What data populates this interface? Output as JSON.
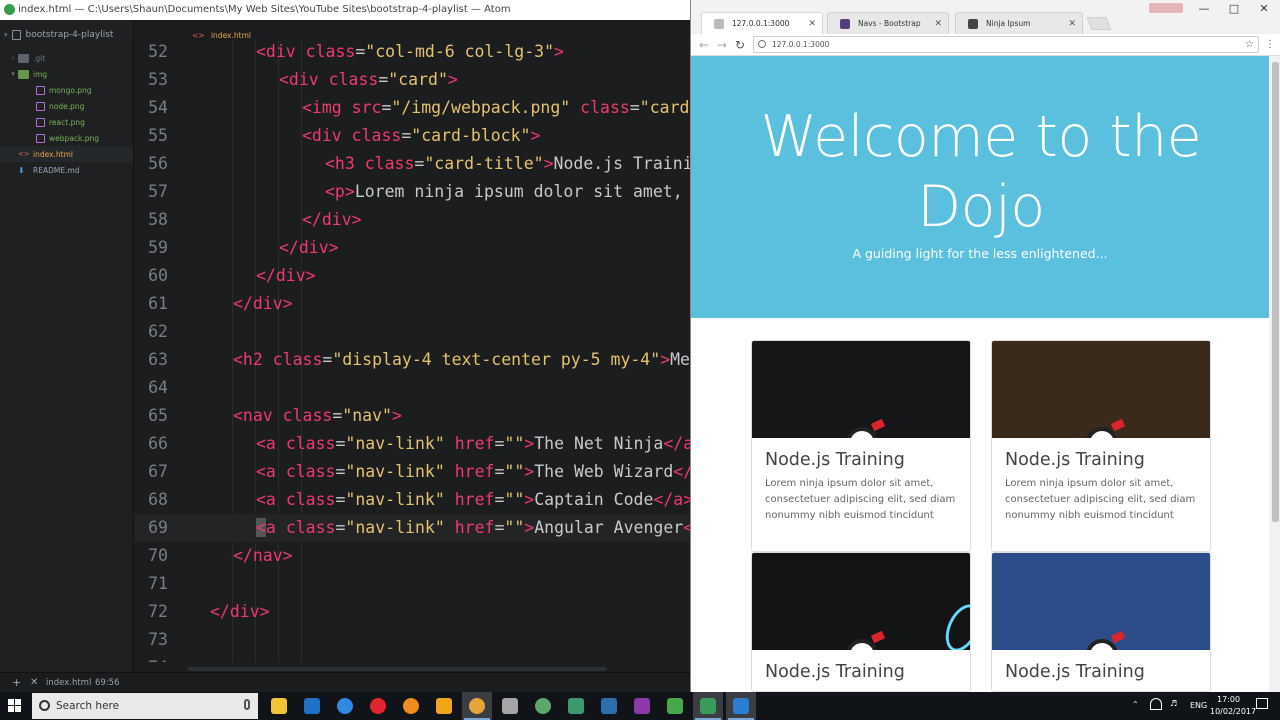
{
  "atom": {
    "title": "index.html — C:\\Users\\Shaun\\Documents\\My Web Sites\\YouTube Sites\\bootstrap-4-playlist — Atom",
    "project": "bootstrap-4-playlist",
    "tree": [
      {
        "label": ".git",
        "color": "#6e7681",
        "indent": 1,
        "kind": "folder",
        "open": false
      },
      {
        "label": "img",
        "color": "#79b45a",
        "indent": 1,
        "kind": "folder",
        "open": true
      },
      {
        "label": "mongo.png",
        "color": "#79b45a",
        "indent": 2,
        "kind": "image"
      },
      {
        "label": "node.png",
        "color": "#79b45a",
        "indent": 2,
        "kind": "image"
      },
      {
        "label": "react.png",
        "color": "#79b45a",
        "indent": 2,
        "kind": "image"
      },
      {
        "label": "webpack.png",
        "color": "#79b45a",
        "indent": 2,
        "kind": "image"
      },
      {
        "label": "index.html",
        "color": "#e6a34c",
        "indent": 1,
        "kind": "html"
      },
      {
        "label": "README.md",
        "color": "#9da5b4",
        "indent": 1,
        "kind": "md"
      }
    ],
    "active_tab": "index.html",
    "status_file": "index.html",
    "status_pos": "69:56",
    "current_line": 69,
    "lines": [
      {
        "n": "52",
        "indent": 2,
        "tokens": [
          [
            "tg",
            "<div "
          ],
          [
            "at",
            "class"
          ],
          [
            "pn",
            "="
          ],
          [
            "st",
            "\"col-md-6 col-lg-3\""
          ],
          [
            "tg",
            ">"
          ]
        ]
      },
      {
        "n": "53",
        "indent": 3,
        "tokens": [
          [
            "tg",
            "<div "
          ],
          [
            "at",
            "class"
          ],
          [
            "pn",
            "="
          ],
          [
            "st",
            "\"card\""
          ],
          [
            "tg",
            ">"
          ]
        ]
      },
      {
        "n": "54",
        "indent": 4,
        "tokens": [
          [
            "tg",
            "<img "
          ],
          [
            "at",
            "src"
          ],
          [
            "pn",
            "="
          ],
          [
            "st",
            "\"/img/webpack.png\""
          ],
          [
            "pn",
            " "
          ],
          [
            "at",
            "class"
          ],
          [
            "pn",
            "="
          ],
          [
            "st",
            "\"card"
          ]
        ]
      },
      {
        "n": "55",
        "indent": 4,
        "tokens": [
          [
            "tg",
            "<div "
          ],
          [
            "at",
            "class"
          ],
          [
            "pn",
            "="
          ],
          [
            "st",
            "\"card-block\""
          ],
          [
            "tg",
            ">"
          ]
        ]
      },
      {
        "n": "56",
        "indent": 5,
        "tokens": [
          [
            "tg",
            "<h3 "
          ],
          [
            "at",
            "class"
          ],
          [
            "pn",
            "="
          ],
          [
            "st",
            "\"card-title\""
          ],
          [
            "tg",
            ">"
          ],
          [
            "tx",
            "Node.js Training-"
          ]
        ]
      },
      {
        "n": "57",
        "indent": 5,
        "tokens": [
          [
            "tg",
            "<p>"
          ],
          [
            "tx",
            "Lorem ninja ipsum dolor sit amet, co"
          ]
        ]
      },
      {
        "n": "58",
        "indent": 4,
        "tokens": [
          [
            "tg",
            "</div>"
          ]
        ]
      },
      {
        "n": "59",
        "indent": 3,
        "tokens": [
          [
            "tg",
            "</div>"
          ]
        ]
      },
      {
        "n": "60",
        "indent": 2,
        "tokens": [
          [
            "tg",
            "</div>"
          ]
        ]
      },
      {
        "n": "61",
        "indent": 1,
        "tokens": [
          [
            "tg",
            "</div>"
          ]
        ]
      },
      {
        "n": "62",
        "indent": 0,
        "tokens": []
      },
      {
        "n": "63",
        "indent": 1,
        "tokens": [
          [
            "tg",
            "<h2 "
          ],
          [
            "at",
            "class"
          ],
          [
            "pn",
            "="
          ],
          [
            "st",
            "\"display-4 text-center py-5 my-4\""
          ],
          [
            "tg",
            ">"
          ],
          [
            "tx",
            "Mee"
          ]
        ]
      },
      {
        "n": "64",
        "indent": 0,
        "tokens": []
      },
      {
        "n": "65",
        "indent": 1,
        "tokens": [
          [
            "tg",
            "<nav "
          ],
          [
            "at",
            "class"
          ],
          [
            "pn",
            "="
          ],
          [
            "st",
            "\"nav\""
          ],
          [
            "tg",
            ">"
          ]
        ]
      },
      {
        "n": "66",
        "indent": 2,
        "tokens": [
          [
            "tg",
            "<a "
          ],
          [
            "at",
            "class"
          ],
          [
            "pn",
            "="
          ],
          [
            "st",
            "\"nav-link\""
          ],
          [
            "pn",
            " "
          ],
          [
            "at",
            "href"
          ],
          [
            "pn",
            "="
          ],
          [
            "st",
            "\"\""
          ],
          [
            "tg",
            ">"
          ],
          [
            "tx",
            "The Net Ninja"
          ],
          [
            "tg",
            "</a>"
          ]
        ]
      },
      {
        "n": "67",
        "indent": 2,
        "tokens": [
          [
            "tg",
            "<a "
          ],
          [
            "at",
            "class"
          ],
          [
            "pn",
            "="
          ],
          [
            "st",
            "\"nav-link\""
          ],
          [
            "pn",
            " "
          ],
          [
            "at",
            "href"
          ],
          [
            "pn",
            "="
          ],
          [
            "st",
            "\"\""
          ],
          [
            "tg",
            ">"
          ],
          [
            "tx",
            "The Web Wizard"
          ],
          [
            "tg",
            "</"
          ]
        ]
      },
      {
        "n": "68",
        "indent": 2,
        "tokens": [
          [
            "tg",
            "<a "
          ],
          [
            "at",
            "class"
          ],
          [
            "pn",
            "="
          ],
          [
            "st",
            "\"nav-link\""
          ],
          [
            "pn",
            " "
          ],
          [
            "at",
            "href"
          ],
          [
            "pn",
            "="
          ],
          [
            "st",
            "\"\""
          ],
          [
            "tg",
            ">"
          ],
          [
            "tx",
            "Captain Code"
          ],
          [
            "tg",
            "</a>"
          ]
        ]
      },
      {
        "n": "69",
        "indent": 2,
        "tokens": [
          [
            "tg",
            "<a "
          ],
          [
            "at",
            "class"
          ],
          [
            "pn",
            "="
          ],
          [
            "st",
            "\"nav-link\""
          ],
          [
            "pn",
            " "
          ],
          [
            "at",
            "href"
          ],
          [
            "pn",
            "="
          ],
          [
            "st",
            "\"\""
          ],
          [
            "tg",
            ">"
          ],
          [
            "tx",
            "Angular Avenger"
          ],
          [
            "tg",
            "</"
          ]
        ]
      },
      {
        "n": "70",
        "indent": 1,
        "tokens": [
          [
            "tg",
            "</nav>"
          ]
        ]
      },
      {
        "n": "71",
        "indent": 0,
        "tokens": []
      },
      {
        "n": "72",
        "indent": 0,
        "tokens": [
          [
            "tg",
            "</div>"
          ]
        ]
      },
      {
        "n": "73",
        "indent": 0,
        "tokens": []
      },
      {
        "n": "74",
        "indent": 0,
        "tokens": []
      }
    ]
  },
  "chrome": {
    "tabs": [
      {
        "label": "127.0.0.1:3000",
        "favicon": "#bbbbbb",
        "active": true
      },
      {
        "label": "Navs - Bootstrap",
        "favicon": "#563d7c",
        "active": false
      },
      {
        "label": "Ninja Ipsum",
        "favicon": "#444444",
        "active": false
      }
    ],
    "url": "127.0.0.1:3000",
    "page": {
      "jumbo_bg": "#5bc0de",
      "heading": "Welcome to the Dojo",
      "subheading": "A guiding light for the less enlightened...",
      "cards": [
        {
          "title": "Node.js Training",
          "text": "Lorem ninja ipsum dolor sit amet, consectetuer adipiscing elit, sed diam nonummy nibh euismod tincidunt",
          "bg": "#151617"
        },
        {
          "title": "Node.js Training",
          "text": "Lorem ninja ipsum dolor sit amet, consectetuer adipiscing elit, sed diam nonummy nibh euismod tincidunt",
          "bg": "#3a2a1c"
        },
        {
          "title": "Node.js Training",
          "text": "",
          "bg": "#131415"
        },
        {
          "title": "Node.js Training",
          "text": "",
          "bg": "#2c4d8a"
        }
      ]
    }
  },
  "taskbar": {
    "search_placeholder": "Search here",
    "apps": [
      {
        "name": "file-explorer-icon",
        "color": "#f3c536"
      },
      {
        "name": "outlook-icon",
        "color": "#1e73c8"
      },
      {
        "name": "edge-icon",
        "color": "#2d8ae0"
      },
      {
        "name": "opera-icon",
        "color": "#e0262c"
      },
      {
        "name": "firefox-icon",
        "color": "#f08b1d"
      },
      {
        "name": "filezilla-icon",
        "color": "#f2a516"
      },
      {
        "name": "chrome-icon",
        "color": "#e4a53a"
      },
      {
        "name": "app-icon",
        "color": "#a6a6a6"
      },
      {
        "name": "node-icon",
        "color": "#5aa86a"
      },
      {
        "name": "camtasia-icon",
        "color": "#3b9b6d"
      },
      {
        "name": "photoshop-icon",
        "color": "#2d6fa8"
      },
      {
        "name": "premiere-icon",
        "color": "#8b3aa8"
      },
      {
        "name": "dreamweaver-icon",
        "color": "#47a84b"
      },
      {
        "name": "atom-icon",
        "color": "#3c9a5a"
      },
      {
        "name": "play-icon",
        "color": "#2a7fd4"
      }
    ],
    "lang": "ENG",
    "time": "17:00",
    "date": "10/02/2017"
  }
}
